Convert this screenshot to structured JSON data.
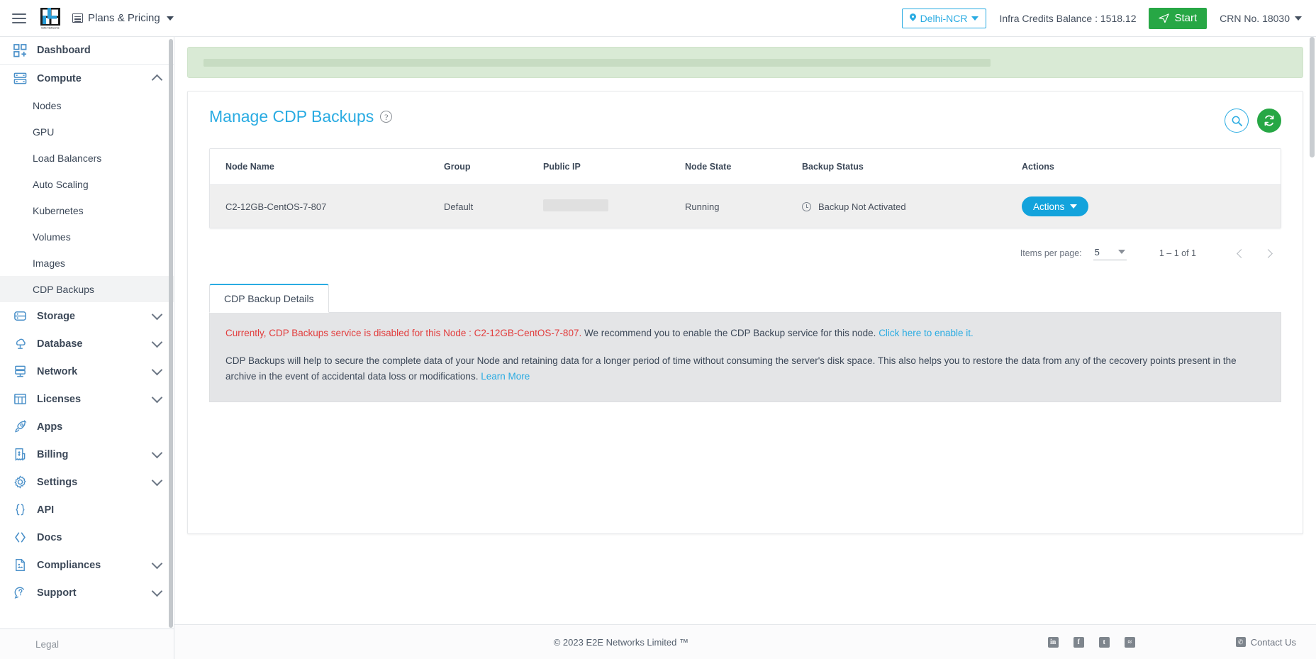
{
  "topbar": {
    "menu_icon": "hamburger-icon",
    "logo_alt": "E2E Networks",
    "plans_label": "Plans & Pricing",
    "region_label": "Delhi-NCR",
    "credits_label": "Infra Credits Balance : 1518.12",
    "start_label": "Start",
    "crn_label": "CRN No. 18030"
  },
  "sidebar": {
    "items": [
      {
        "label": "Dashboard",
        "icon": "dashboard-icon",
        "expandable": false
      },
      {
        "label": "Compute",
        "icon": "server-icon",
        "expandable": true,
        "expanded": true
      },
      {
        "label": "Storage",
        "icon": "database-icon",
        "expandable": true,
        "expanded": false
      },
      {
        "label": "Database",
        "icon": "cloud-database-icon",
        "expandable": true,
        "expanded": false
      },
      {
        "label": "Network",
        "icon": "network-icon",
        "expandable": true,
        "expanded": false
      },
      {
        "label": "Licenses",
        "icon": "license-grid-icon",
        "expandable": true,
        "expanded": false
      },
      {
        "label": "Apps",
        "icon": "rocket-icon",
        "expandable": false
      },
      {
        "label": "Billing",
        "icon": "invoice-icon",
        "expandable": true,
        "expanded": false
      },
      {
        "label": "Settings",
        "icon": "gear-icon",
        "expandable": true,
        "expanded": false
      },
      {
        "label": "API",
        "icon": "braces-icon",
        "expandable": false
      },
      {
        "label": "Docs",
        "icon": "code-brackets-icon",
        "expandable": false
      },
      {
        "label": "Compliances",
        "icon": "document-icon",
        "expandable": true,
        "expanded": false
      },
      {
        "label": "Support",
        "icon": "support-icon",
        "expandable": true,
        "expanded": false
      }
    ],
    "compute_children": [
      {
        "label": "Nodes",
        "active": false
      },
      {
        "label": "GPU",
        "active": false
      },
      {
        "label": "Load Balancers",
        "active": false
      },
      {
        "label": "Auto Scaling",
        "active": false
      },
      {
        "label": "Kubernetes",
        "active": false
      },
      {
        "label": "Volumes",
        "active": false
      },
      {
        "label": "Images",
        "active": false
      },
      {
        "label": "CDP Backups",
        "active": true
      }
    ],
    "legal_label": "Legal"
  },
  "page": {
    "title": "Manage CDP Backups",
    "help_icon": "question-mark-icon",
    "search_icon": "search-icon",
    "refresh_icon": "refresh-icon"
  },
  "table": {
    "columns": [
      "Node Name",
      "Group",
      "Public IP",
      "Node State",
      "Backup Status",
      "Actions"
    ],
    "rows": [
      {
        "node_name": "C2-12GB-CentOS-7-807",
        "group": "Default",
        "public_ip": "",
        "node_state": "Running",
        "backup_status": "Backup Not Activated",
        "backup_status_icon": "clock-icon",
        "action_label": "Actions"
      }
    ]
  },
  "paginator": {
    "items_per_page_label": "Items per page:",
    "items_per_page_value": "5",
    "range_label": "1 – 1 of 1",
    "prev_icon": "chevron-left-icon",
    "next_icon": "chevron-right-icon"
  },
  "tabs": [
    {
      "label": "CDP Backup Details",
      "active": true
    }
  ],
  "info": {
    "warning_text": "Currently, CDP Backups service is disabled for this Node : C2-12GB-CentOS-7-807.",
    "recommend_text": " We recommend you to enable the CDP Backup service for this node. ",
    "enable_link": "Click here to enable it.",
    "description": "CDP Backups will help to secure the complete data of your Node and retaining data for a longer period of time without consuming the server's disk space. This also helps you to restore the data from any of the cecovery points present in the archive in the event of accidental data loss or modifications. ",
    "learn_more": "Learn More"
  },
  "footer": {
    "copyright": "© 2023 E2E Networks Limited ™",
    "socials": [
      {
        "name": "linkedin-icon",
        "glyph": "in"
      },
      {
        "name": "facebook-icon",
        "glyph": "f"
      },
      {
        "name": "twitter-icon",
        "glyph": "t"
      },
      {
        "name": "rss-icon",
        "glyph": "≈"
      }
    ],
    "contact_label": "Contact Us",
    "contact_icon": "phone-icon"
  },
  "colors": {
    "accent": "#29abe2",
    "success": "#27a745",
    "danger": "#e23c3c",
    "button": "#13a3dc"
  }
}
